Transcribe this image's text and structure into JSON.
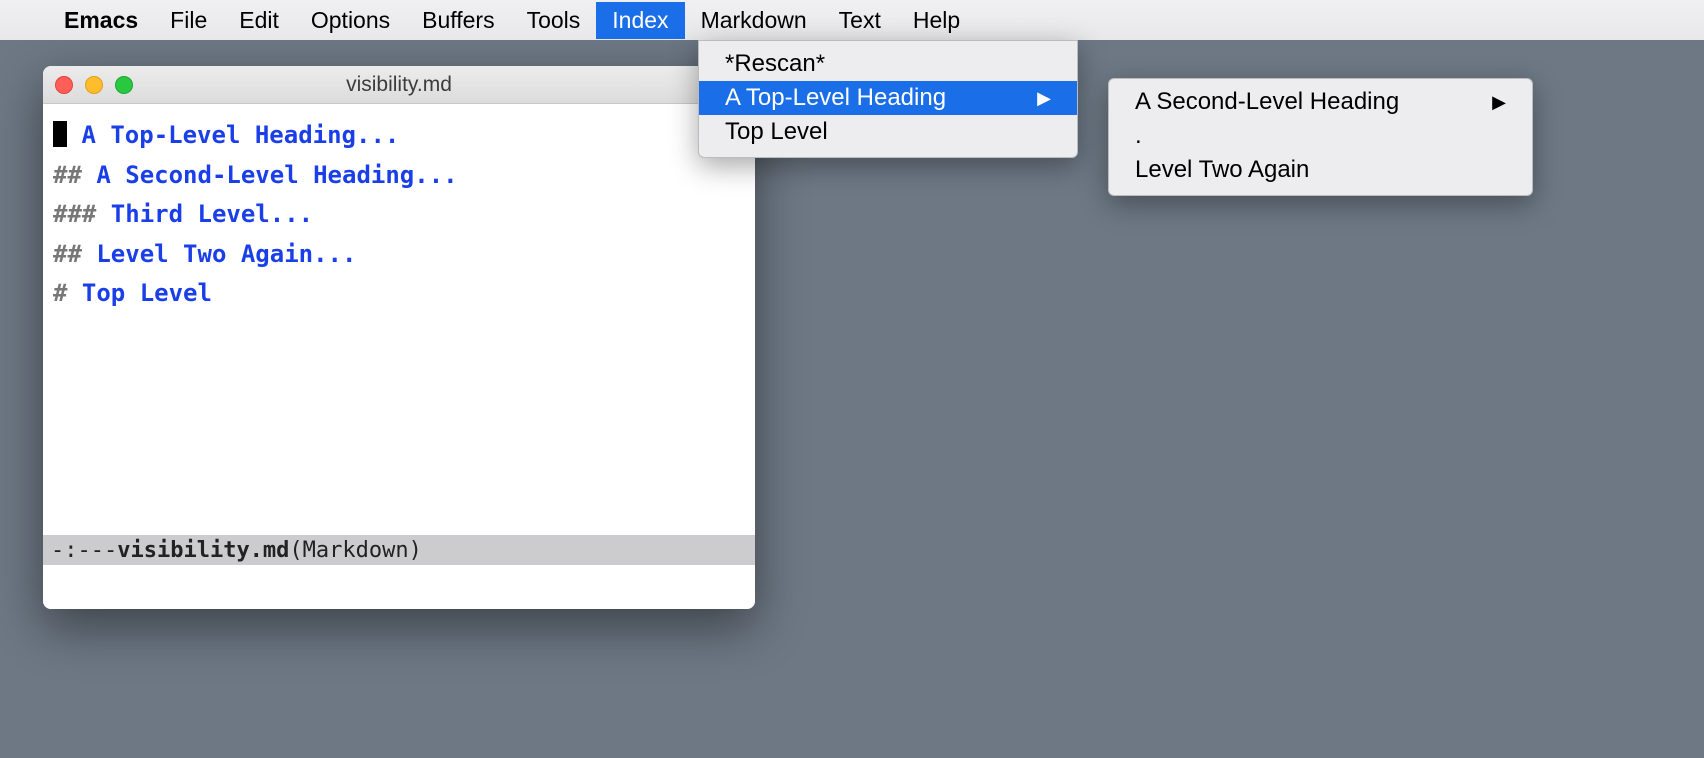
{
  "menubar": {
    "apple": "",
    "appName": "Emacs",
    "items": [
      "File",
      "Edit",
      "Options",
      "Buffers",
      "Tools",
      "Index",
      "Markdown",
      "Text",
      "Help"
    ],
    "activeItem": "Index"
  },
  "indexMenu": {
    "items": [
      {
        "label": "*Rescan*",
        "hasSubmenu": false,
        "highlighted": false
      },
      {
        "label": "A Top-Level Heading",
        "hasSubmenu": true,
        "highlighted": true
      },
      {
        "label": "Top Level",
        "hasSubmenu": false,
        "highlighted": false
      }
    ]
  },
  "submenu": {
    "items": [
      {
        "label": "A Second-Level Heading",
        "hasSubmenu": true
      },
      {
        "label": ".",
        "hasSubmenu": false
      },
      {
        "label": "Level Two Again",
        "hasSubmenu": false
      }
    ]
  },
  "window": {
    "title": "visibility.md"
  },
  "editor": {
    "lines": [
      {
        "prefix": "",
        "cursor": true,
        "text": "A Top-Level Heading..."
      },
      {
        "prefix": "## ",
        "cursor": false,
        "text": "A Second-Level Heading..."
      },
      {
        "prefix": "### ",
        "cursor": false,
        "text": "Third Level..."
      },
      {
        "prefix": "## ",
        "cursor": false,
        "text": "Level Two Again..."
      },
      {
        "prefix": "# ",
        "cursor": false,
        "text": "Top Level"
      }
    ]
  },
  "modeline": {
    "status": "-:--- ",
    "filename": " visibility.md",
    "mode": "   (Markdown)"
  }
}
